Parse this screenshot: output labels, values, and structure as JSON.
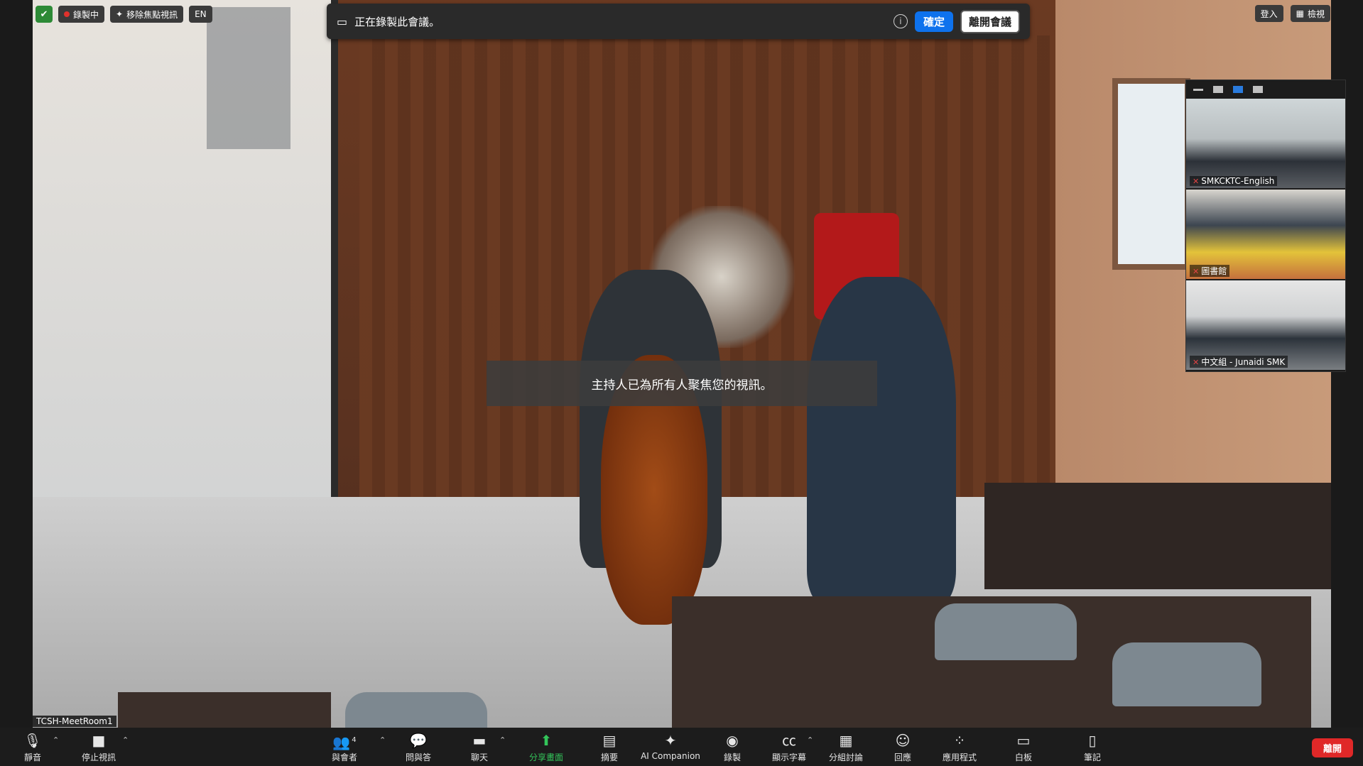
{
  "top_left": {
    "recording_label": "錄製中",
    "remove_spotlight_label": "移除焦點視訊",
    "language_label": "EN"
  },
  "top_right": {
    "login_label": "登入",
    "view_label": "檢視"
  },
  "recording_banner": {
    "message": "正在錄製此會議。",
    "confirm_label": "確定",
    "leave_meeting_label": "離開會議"
  },
  "toast": {
    "message": "主持人已為所有人聚焦您的視訊。"
  },
  "main_video": {
    "participant_name": "TCSH-MeetRoom1"
  },
  "thumbnails": [
    {
      "name": "SMKCKTC-English",
      "muted": true
    },
    {
      "name": "圖書館",
      "muted": true
    },
    {
      "name": "中文組 - Junaidi SMK",
      "muted": true
    }
  ],
  "toolbar": {
    "mute": "靜音",
    "stop_video": "停止視訊",
    "participants": "與會者",
    "participants_count": "4",
    "qa": "問與答",
    "chat": "聊天",
    "share": "分享畫面",
    "summary": "摘要",
    "ai_companion": "AI Companion",
    "record": "錄製",
    "captions": "顯示字幕",
    "breakout": "分組討論",
    "reactions": "回應",
    "apps": "應用程式",
    "whiteboard": "白板",
    "notes": "筆記",
    "leave": "離開"
  },
  "colors": {
    "accent": "#0e72ed",
    "share_green": "#33c55a",
    "leave_red": "#e02828",
    "recording_dot": "#e0312c"
  }
}
